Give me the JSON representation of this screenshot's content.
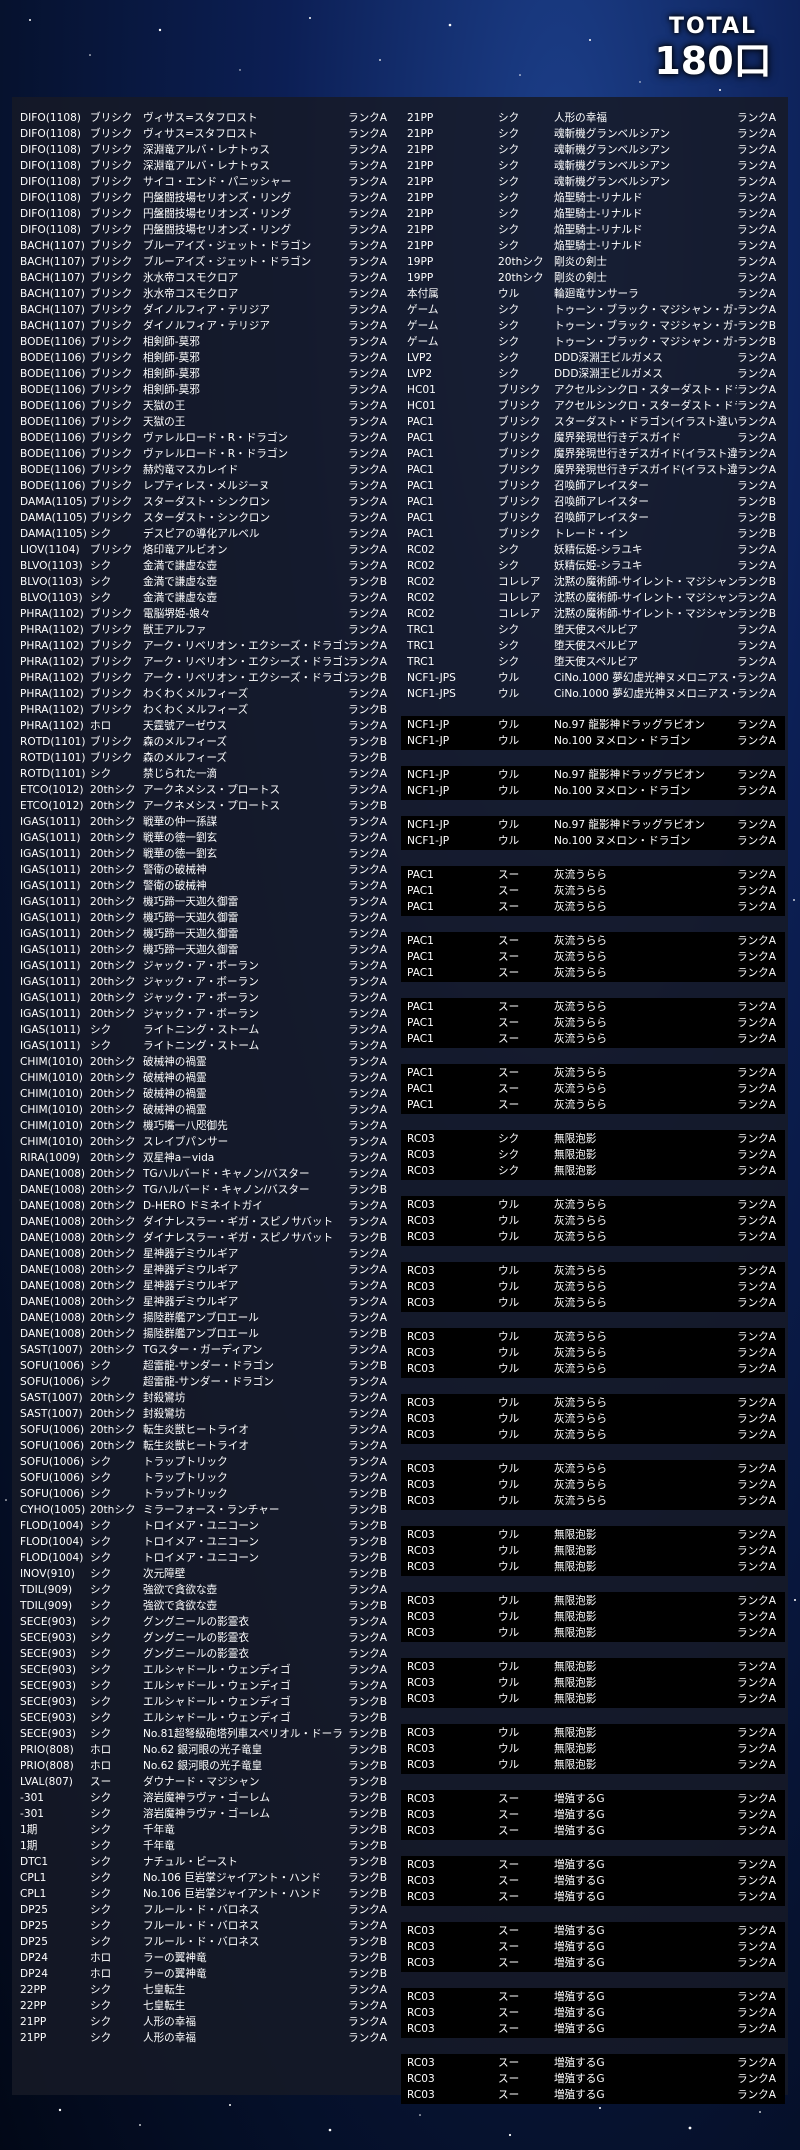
{
  "header": {
    "total_label": "TOTAL",
    "total_count": "180口"
  },
  "left_rows": [
    [
      "DIFO(1108)",
      "ブリシク",
      "ヴィサス=スタフロスト",
      "ランクA"
    ],
    [
      "DIFO(1108)",
      "ブリシク",
      "ヴィサス=スタフロスト",
      "ランクA"
    ],
    [
      "DIFO(1108)",
      "ブリシク",
      "深淵竜アルバ・レナトゥス",
      "ランクA"
    ],
    [
      "DIFO(1108)",
      "ブリシク",
      "深淵竜アルバ・レナトゥス",
      "ランクA"
    ],
    [
      "DIFO(1108)",
      "ブリシク",
      "サイコ・エンド・パニッシャー",
      "ランクA"
    ],
    [
      "DIFO(1108)",
      "ブリシク",
      "円盤闘技場セリオンズ・リング",
      "ランクA"
    ],
    [
      "DIFO(1108)",
      "ブリシク",
      "円盤闘技場セリオンズ・リング",
      "ランクA"
    ],
    [
      "DIFO(1108)",
      "ブリシク",
      "円盤闘技場セリオンズ・リング",
      "ランクA"
    ],
    [
      "BACH(1107)",
      "ブリシク",
      "ブルーアイズ・ジェット・ドラゴン",
      "ランクA"
    ],
    [
      "BACH(1107)",
      "ブリシク",
      "ブルーアイズ・ジェット・ドラゴン",
      "ランクA"
    ],
    [
      "BACH(1107)",
      "ブリシク",
      "氷水帝コスモクロア",
      "ランクA"
    ],
    [
      "BACH(1107)",
      "ブリシク",
      "氷水帝コスモクロア",
      "ランクA"
    ],
    [
      "BACH(1107)",
      "ブリシク",
      "ダイノルフィア・テリジア",
      "ランクA"
    ],
    [
      "BACH(1107)",
      "ブリシク",
      "ダイノルフィア・テリジア",
      "ランクA"
    ],
    [
      "BODE(1106)",
      "ブリシク",
      "相剣師-莫邪",
      "ランクA"
    ],
    [
      "BODE(1106)",
      "ブリシク",
      "相剣師-莫邪",
      "ランクA"
    ],
    [
      "BODE(1106)",
      "ブリシク",
      "相剣師-莫邪",
      "ランクA"
    ],
    [
      "BODE(1106)",
      "ブリシク",
      "相剣師-莫邪",
      "ランクA"
    ],
    [
      "BODE(1106)",
      "ブリシク",
      "天獄の王",
      "ランクA"
    ],
    [
      "BODE(1106)",
      "ブリシク",
      "天獄の王",
      "ランクA"
    ],
    [
      "BODE(1106)",
      "ブリシク",
      "ヴァレルロード・R・ドラゴン",
      "ランクA"
    ],
    [
      "BODE(1106)",
      "ブリシク",
      "ヴァレルロード・R・ドラゴン",
      "ランクA"
    ],
    [
      "BODE(1106)",
      "ブリシク",
      "赫灼竜マスカレイド",
      "ランクA"
    ],
    [
      "BODE(1106)",
      "ブリシク",
      "レプティレス・メルジーヌ",
      "ランクA"
    ],
    [
      "DAMA(1105)",
      "ブリシク",
      "スターダスト・シンクロン",
      "ランクA"
    ],
    [
      "DAMA(1105)",
      "ブリシク",
      "スターダスト・シンクロン",
      "ランクA"
    ],
    [
      "DAMA(1105)",
      "シク",
      "デスピアの導化アルベル",
      "ランクA"
    ],
    [
      "LIOV(1104)",
      "ブリシク",
      "烙印竜アルビオン",
      "ランクA"
    ],
    [
      "BLVO(1103)",
      "シク",
      "金満で謙虚な壺",
      "ランクA"
    ],
    [
      "BLVO(1103)",
      "シク",
      "金満で謙虚な壺",
      "ランクB"
    ],
    [
      "BLVO(1103)",
      "シク",
      "金満で謙虚な壺",
      "ランクA"
    ],
    [
      "PHRA(1102)",
      "ブリシク",
      "電脳堺姫-娘々",
      "ランクA"
    ],
    [
      "PHRA(1102)",
      "ブリシク",
      "獣王アルファ",
      "ランクA"
    ],
    [
      "PHRA(1102)",
      "ブリシク",
      "アーク・リベリオン・エクシーズ・ドラゴン",
      "ランクA"
    ],
    [
      "PHRA(1102)",
      "ブリシク",
      "アーク・リベリオン・エクシーズ・ドラゴン",
      "ランクA"
    ],
    [
      "PHRA(1102)",
      "ブリシク",
      "アーク・リベリオン・エクシーズ・ドラゴン",
      "ランクB"
    ],
    [
      "PHRA(1102)",
      "ブリシク",
      "わくわくメルフィーズ",
      "ランクA"
    ],
    [
      "PHRA(1102)",
      "ブリシク",
      "わくわくメルフィーズ",
      "ランクB"
    ],
    [
      "PHRA(1102)",
      "ホロ",
      "天霆號アーゼウス",
      "ランクA"
    ],
    [
      "ROTD(1101)",
      "ブリシク",
      "森のメルフィーズ",
      "ランクB"
    ],
    [
      "ROTD(1101)",
      "ブリシク",
      "森のメルフィーズ",
      "ランクB"
    ],
    [
      "ROTD(1101)",
      "シク",
      "禁じられた一滴",
      "ランクA"
    ],
    [
      "ETCO(1012)",
      "20thシク",
      "アークネメシス・プロートス",
      "ランクA"
    ],
    [
      "ETCO(1012)",
      "20thシク",
      "アークネメシス・プロートス",
      "ランクB"
    ],
    [
      "IGAS(1011)",
      "20thシク",
      "戦華の仲一孫謀",
      "ランクA"
    ],
    [
      "IGAS(1011)",
      "20thシク",
      "戦華の徳一劉玄",
      "ランクA"
    ],
    [
      "IGAS(1011)",
      "20thシク",
      "戦華の徳一劉玄",
      "ランクA"
    ],
    [
      "IGAS(1011)",
      "20thシク",
      "警衛の破械神",
      "ランクA"
    ],
    [
      "IGAS(1011)",
      "20thシク",
      "警衛の破械神",
      "ランクA"
    ],
    [
      "IGAS(1011)",
      "20thシク",
      "機巧蹄一天迦久御雷",
      "ランクA"
    ],
    [
      "IGAS(1011)",
      "20thシク",
      "機巧蹄一天迦久御雷",
      "ランクA"
    ],
    [
      "IGAS(1011)",
      "20thシク",
      "機巧蹄一天迦久御雷",
      "ランクA"
    ],
    [
      "IGAS(1011)",
      "20thシク",
      "機巧蹄一天迦久御雷",
      "ランクA"
    ],
    [
      "IGAS(1011)",
      "20thシク",
      "ジャック・ア・ボーラン",
      "ランクA"
    ],
    [
      "IGAS(1011)",
      "20thシク",
      "ジャック・ア・ボーラン",
      "ランクA"
    ],
    [
      "IGAS(1011)",
      "20thシク",
      "ジャック・ア・ボーラン",
      "ランクA"
    ],
    [
      "IGAS(1011)",
      "20thシク",
      "ジャック・ア・ボーラン",
      "ランクA"
    ],
    [
      "IGAS(1011)",
      "シク",
      "ライトニング・ストーム",
      "ランクA"
    ],
    [
      "IGAS(1011)",
      "シク",
      "ライトニング・ストーム",
      "ランクA"
    ],
    [
      "CHIM(1010)",
      "20thシク",
      "破械神の禍霊",
      "ランクA"
    ],
    [
      "CHIM(1010)",
      "20thシク",
      "破械神の禍霊",
      "ランクA"
    ],
    [
      "CHIM(1010)",
      "20thシク",
      "破械神の禍霊",
      "ランクA"
    ],
    [
      "CHIM(1010)",
      "20thシク",
      "破械神の禍霊",
      "ランクA"
    ],
    [
      "CHIM(1010)",
      "20thシク",
      "機巧嘴一八咫御先",
      "ランクA"
    ],
    [
      "CHIM(1010)",
      "20thシク",
      "スレイブパンサー",
      "ランクA"
    ],
    [
      "RIRA(1009)",
      "20thシク",
      "双星神a－vida",
      "ランクA"
    ],
    [
      "DANE(1008)",
      "20thシク",
      "TGハルバード・キャノン/バスター",
      "ランクA"
    ],
    [
      "DANE(1008)",
      "20thシク",
      "TGハルバード・キャノン/バスター",
      "ランクB"
    ],
    [
      "DANE(1008)",
      "20thシク",
      "D-HERO ドミネイトガイ",
      "ランクA"
    ],
    [
      "DANE(1008)",
      "20thシク",
      "ダイナレスラー・ギガ・スピノサバット",
      "ランクA"
    ],
    [
      "DANE(1008)",
      "20thシク",
      "ダイナレスラー・ギガ・スピノサバット",
      "ランクB"
    ],
    [
      "DANE(1008)",
      "20thシク",
      "星神器デミウルギア",
      "ランクA"
    ],
    [
      "DANE(1008)",
      "20thシク",
      "星神器デミウルギア",
      "ランクA"
    ],
    [
      "DANE(1008)",
      "20thシク",
      "星神器デミウルギア",
      "ランクA"
    ],
    [
      "DANE(1008)",
      "20thシク",
      "星神器デミウルギア",
      "ランクA"
    ],
    [
      "DANE(1008)",
      "20thシク",
      "揚陸群艦アンブロエール",
      "ランクA"
    ],
    [
      "DANE(1008)",
      "20thシク",
      "揚陸群艦アンブロエール",
      "ランクB"
    ],
    [
      "SAST(1007)",
      "20thシク",
      "TGスター・ガーディアン",
      "ランクA"
    ],
    [
      "SOFU(1006)",
      "シク",
      "超雷龍-サンダー・ドラゴン",
      "ランクB"
    ],
    [
      "SOFU(1006)",
      "シク",
      "超雷龍-サンダー・ドラゴン",
      "ランクA"
    ],
    [
      "SAST(1007)",
      "20thシク",
      "封殺鸞坊",
      "ランクA"
    ],
    [
      "SAST(1007)",
      "20thシク",
      "封殺鸞坊",
      "ランクA"
    ],
    [
      "SOFU(1006)",
      "20thシク",
      "転生炎獣ヒートライオ",
      "ランクA"
    ],
    [
      "SOFU(1006)",
      "20thシク",
      "転生炎獣ヒートライオ",
      "ランクA"
    ],
    [
      "SOFU(1006)",
      "シク",
      "トラップトリック",
      "ランクA"
    ],
    [
      "SOFU(1006)",
      "シク",
      "トラップトリック",
      "ランクA"
    ],
    [
      "SOFU(1006)",
      "シク",
      "トラップトリック",
      "ランクB"
    ],
    [
      "CYHO(1005)",
      "20thシク",
      "ミラーフォース・ランチャー",
      "ランクB"
    ],
    [
      "FLOD(1004)",
      "シク",
      "トロイメア・ユニコーン",
      "ランクB"
    ],
    [
      "FLOD(1004)",
      "シク",
      "トロイメア・ユニコーン",
      "ランクB"
    ],
    [
      "FLOD(1004)",
      "シク",
      "トロイメア・ユニコーン",
      "ランクB"
    ],
    [
      "INOV(910)",
      "シク",
      "次元障壁",
      "ランクB"
    ],
    [
      "TDIL(909)",
      "シク",
      "強欲で貪欲な壺",
      "ランクA"
    ],
    [
      "TDIL(909)",
      "シク",
      "強欲で貪欲な壺",
      "ランクB"
    ],
    [
      "SECE(903)",
      "シク",
      "グングニールの影霊衣",
      "ランクA"
    ],
    [
      "SECE(903)",
      "シク",
      "グングニールの影霊衣",
      "ランクA"
    ],
    [
      "SECE(903)",
      "シク",
      "グングニールの影霊衣",
      "ランクA"
    ],
    [
      "SECE(903)",
      "シク",
      "エルシャドール・ウェンディゴ",
      "ランクA"
    ],
    [
      "SECE(903)",
      "シク",
      "エルシャドール・ウェンディゴ",
      "ランクA"
    ],
    [
      "SECE(903)",
      "シク",
      "エルシャドール・ウェンディゴ",
      "ランクB"
    ],
    [
      "SECE(903)",
      "シク",
      "エルシャドール・ウェンディゴ",
      "ランクB"
    ],
    [
      "SECE(903)",
      "シク",
      "No.81超弩級砲塔列車スペリオル・ドーラ",
      "ランクB"
    ],
    [
      "PRIO(808)",
      "ホロ",
      "No.62 銀河眼の光子竜皇",
      "ランクB"
    ],
    [
      "PRIO(808)",
      "ホロ",
      "No.62 銀河眼の光子竜皇",
      "ランクB"
    ],
    [
      "LVAL(807)",
      "スー",
      "ダウナード・マジシャン",
      "ランクB"
    ],
    [
      "-301",
      "シク",
      "溶岩魔神ラヴァ・ゴーレム",
      "ランクB"
    ],
    [
      "-301",
      "シク",
      "溶岩魔神ラヴァ・ゴーレム",
      "ランクB"
    ],
    [
      "1期",
      "シク",
      "千年竜",
      "ランクB"
    ],
    [
      "1期",
      "シク",
      "千年竜",
      "ランクB"
    ],
    [
      "DTC1",
      "シク",
      "ナチュル・ビースト",
      "ランクB"
    ],
    [
      "CPL1",
      "シク",
      "No.106 巨岩掌ジャイアント・ハンド",
      "ランクB"
    ],
    [
      "CPL1",
      "シク",
      "No.106 巨岩掌ジャイアント・ハンド",
      "ランクB"
    ],
    [
      "DP25",
      "シク",
      "フルール・ド・バロネス",
      "ランクA"
    ],
    [
      "DP25",
      "シク",
      "フルール・ド・バロネス",
      "ランクA"
    ],
    [
      "DP25",
      "シク",
      "フルール・ド・バロネス",
      "ランクB"
    ],
    [
      "DP24",
      "ホロ",
      "ラーの翼神竜",
      "ランクB"
    ],
    [
      "DP24",
      "ホロ",
      "ラーの翼神竜",
      "ランクB"
    ],
    [
      "22PP",
      "シク",
      "七皇転生",
      "ランクA"
    ],
    [
      "22PP",
      "シク",
      "七皇転生",
      "ランクA"
    ],
    [
      "21PP",
      "シク",
      "人形の幸福",
      "ランクA"
    ],
    [
      "21PP",
      "シク",
      "人形の幸福",
      "ランクA"
    ]
  ],
  "right_rows": [
    [
      "21PP",
      "シク",
      "人形の幸福",
      "ランクA"
    ],
    [
      "21PP",
      "シク",
      "魂斬機グランベルシアン",
      "ランクA"
    ],
    [
      "21PP",
      "シク",
      "魂斬機グランベルシアン",
      "ランクA"
    ],
    [
      "21PP",
      "シク",
      "魂斬機グランベルシアン",
      "ランクA"
    ],
    [
      "21PP",
      "シク",
      "魂斬機グランベルシアン",
      "ランクA"
    ],
    [
      "21PP",
      "シク",
      "焔聖騎士-リナルド",
      "ランクA"
    ],
    [
      "21PP",
      "シク",
      "焔聖騎士-リナルド",
      "ランクA"
    ],
    [
      "21PP",
      "シク",
      "焔聖騎士-リナルド",
      "ランクA"
    ],
    [
      "21PP",
      "シク",
      "焔聖騎士-リナルド",
      "ランクA"
    ],
    [
      "19PP",
      "20thシク",
      "剛炎の剣士",
      "ランクA"
    ],
    [
      "19PP",
      "20thシク",
      "剛炎の剣士",
      "ランクA"
    ],
    [
      "本付属",
      "ウル",
      "輪廻竜サンサーラ",
      "ランクA"
    ],
    [
      "ゲーム",
      "シク",
      "トゥーン・ブラック・マジシャン・ガール",
      "ランクA"
    ],
    [
      "ゲーム",
      "シク",
      "トゥーン・ブラック・マジシャン・ガール",
      "ランクB"
    ],
    [
      "ゲーム",
      "シク",
      "トゥーン・ブラック・マジシャン・ガール",
      "ランクB"
    ],
    [
      "LVP2",
      "シク",
      "DDD深淵王ビルガメス",
      "ランクA"
    ],
    [
      "LVP2",
      "シク",
      "DDD深淵王ビルガメス",
      "ランクA"
    ],
    [
      "HC01",
      "ブリシク",
      "アクセルシンクロ・スターダスト・ドラゴン",
      "ランクA"
    ],
    [
      "HC01",
      "ブリシク",
      "アクセルシンクロ・スターダスト・ドラゴン",
      "ランクA"
    ],
    [
      "PAC1",
      "ブリシク",
      "スターダスト・ドラゴン(イラスト違い)",
      "ランクA"
    ],
    [
      "PAC1",
      "ブリシク",
      "魔界発現世行きデスガイド",
      "ランクA"
    ],
    [
      "PAC1",
      "ブリシク",
      "魔界発現世行きデスガイド(イラスト違い)",
      "ランクA"
    ],
    [
      "PAC1",
      "ブリシク",
      "魔界発現世行きデスガイド(イラスト違い)",
      "ランクA"
    ],
    [
      "PAC1",
      "ブリシク",
      "召喚師アレイスター",
      "ランクA"
    ],
    [
      "PAC1",
      "ブリシク",
      "召喚師アレイスター",
      "ランクB"
    ],
    [
      "PAC1",
      "ブリシク",
      "召喚師アレイスター",
      "ランクB"
    ],
    [
      "PAC1",
      "ブリシク",
      "トレード・イン",
      "ランクB"
    ],
    [
      "RC02",
      "シク",
      "妖精伝姫-シラユキ",
      "ランクA"
    ],
    [
      "RC02",
      "シク",
      "妖精伝姫-シラユキ",
      "ランクA"
    ],
    [
      "RC02",
      "コレレア",
      "沈黙の魔術師-サイレント・マジシャン",
      "ランクB"
    ],
    [
      "RC02",
      "コレレア",
      "沈黙の魔術師-サイレント・マジシャン",
      "ランクA"
    ],
    [
      "RC02",
      "コレレア",
      "沈黙の魔術師-サイレント・マジシャン",
      "ランクB"
    ],
    [
      "TRC1",
      "シク",
      "堕天使スペルビア",
      "ランクA"
    ],
    [
      "TRC1",
      "シク",
      "堕天使スペルビア",
      "ランクA"
    ],
    [
      "TRC1",
      "シク",
      "堕天使スペルビア",
      "ランクA"
    ],
    [
      "NCF1-JPS",
      "ウル",
      "CiNo.1000 夢幻虚光神ヌメロニアス・ヌメロニア",
      "ランクA"
    ],
    [
      "NCF1-JPS",
      "ウル",
      "CiNo.1000 夢幻虚光神ヌメロニアス・ヌメロニア",
      "ランクA"
    ]
  ],
  "right_blocks": [
    [
      [
        "NCF1-JP",
        "ウル",
        "No.97 龍影神ドラッグラビオン",
        "ランクA"
      ],
      [
        "NCF1-JP",
        "ウル",
        "No.100 ヌメロン・ドラゴン",
        "ランクA"
      ]
    ],
    [
      [
        "NCF1-JP",
        "ウル",
        "No.97 龍影神ドラッグラビオン",
        "ランクA"
      ],
      [
        "NCF1-JP",
        "ウル",
        "No.100 ヌメロン・ドラゴン",
        "ランクA"
      ]
    ],
    [
      [
        "NCF1-JP",
        "ウル",
        "No.97 龍影神ドラッグラビオン",
        "ランクA"
      ],
      [
        "NCF1-JP",
        "ウル",
        "No.100 ヌメロン・ドラゴン",
        "ランクA"
      ]
    ],
    [
      [
        "PAC1",
        "スー",
        "灰流うらら",
        "ランクA"
      ],
      [
        "PAC1",
        "スー",
        "灰流うらら",
        "ランクA"
      ],
      [
        "PAC1",
        "スー",
        "灰流うらら",
        "ランクA"
      ]
    ],
    [
      [
        "PAC1",
        "スー",
        "灰流うらら",
        "ランクA"
      ],
      [
        "PAC1",
        "スー",
        "灰流うらら",
        "ランクA"
      ],
      [
        "PAC1",
        "スー",
        "灰流うらら",
        "ランクA"
      ]
    ],
    [
      [
        "PAC1",
        "スー",
        "灰流うらら",
        "ランクA"
      ],
      [
        "PAC1",
        "スー",
        "灰流うらら",
        "ランクA"
      ],
      [
        "PAC1",
        "スー",
        "灰流うらら",
        "ランクA"
      ]
    ],
    [
      [
        "PAC1",
        "スー",
        "灰流うらら",
        "ランクA"
      ],
      [
        "PAC1",
        "スー",
        "灰流うらら",
        "ランクA"
      ],
      [
        "PAC1",
        "スー",
        "灰流うらら",
        "ランクA"
      ]
    ],
    [
      [
        "RC03",
        "シク",
        "無限泡影",
        "ランクA"
      ],
      [
        "RC03",
        "シク",
        "無限泡影",
        "ランクA"
      ],
      [
        "RC03",
        "シク",
        "無限泡影",
        "ランクA"
      ]
    ],
    [
      [
        "RC03",
        "ウル",
        "灰流うらら",
        "ランクA"
      ],
      [
        "RC03",
        "ウル",
        "灰流うらら",
        "ランクA"
      ],
      [
        "RC03",
        "ウル",
        "灰流うらら",
        "ランクA"
      ]
    ],
    [
      [
        "RC03",
        "ウル",
        "灰流うらら",
        "ランクA"
      ],
      [
        "RC03",
        "ウル",
        "灰流うらら",
        "ランクA"
      ],
      [
        "RC03",
        "ウル",
        "灰流うらら",
        "ランクA"
      ]
    ],
    [
      [
        "RC03",
        "ウル",
        "灰流うらら",
        "ランクA"
      ],
      [
        "RC03",
        "ウル",
        "灰流うらら",
        "ランクA"
      ],
      [
        "RC03",
        "ウル",
        "灰流うらら",
        "ランクA"
      ]
    ],
    [
      [
        "RC03",
        "ウル",
        "灰流うらら",
        "ランクA"
      ],
      [
        "RC03",
        "ウル",
        "灰流うらら",
        "ランクA"
      ],
      [
        "RC03",
        "ウル",
        "灰流うらら",
        "ランクA"
      ]
    ],
    [
      [
        "RC03",
        "ウル",
        "灰流うらら",
        "ランクA"
      ],
      [
        "RC03",
        "ウル",
        "灰流うらら",
        "ランクA"
      ],
      [
        "RC03",
        "ウル",
        "灰流うらら",
        "ランクA"
      ]
    ],
    [
      [
        "RC03",
        "ウル",
        "無限泡影",
        "ランクA"
      ],
      [
        "RC03",
        "ウル",
        "無限泡影",
        "ランクA"
      ],
      [
        "RC03",
        "ウル",
        "無限泡影",
        "ランクA"
      ]
    ],
    [
      [
        "RC03",
        "ウル",
        "無限泡影",
        "ランクA"
      ],
      [
        "RC03",
        "ウル",
        "無限泡影",
        "ランクA"
      ],
      [
        "RC03",
        "ウル",
        "無限泡影",
        "ランクA"
      ]
    ],
    [
      [
        "RC03",
        "ウル",
        "無限泡影",
        "ランクA"
      ],
      [
        "RC03",
        "ウル",
        "無限泡影",
        "ランクA"
      ],
      [
        "RC03",
        "ウル",
        "無限泡影",
        "ランクA"
      ]
    ],
    [
      [
        "RC03",
        "ウル",
        "無限泡影",
        "ランクA"
      ],
      [
        "RC03",
        "ウル",
        "無限泡影",
        "ランクA"
      ],
      [
        "RC03",
        "ウル",
        "無限泡影",
        "ランクA"
      ]
    ],
    [
      [
        "RC03",
        "スー",
        "増殖するG",
        "ランクA"
      ],
      [
        "RC03",
        "スー",
        "増殖するG",
        "ランクA"
      ],
      [
        "RC03",
        "スー",
        "増殖するG",
        "ランクA"
      ]
    ],
    [
      [
        "RC03",
        "スー",
        "増殖するG",
        "ランクA"
      ],
      [
        "RC03",
        "スー",
        "増殖するG",
        "ランクA"
      ],
      [
        "RC03",
        "スー",
        "増殖するG",
        "ランクA"
      ]
    ],
    [
      [
        "RC03",
        "スー",
        "増殖するG",
        "ランクA"
      ],
      [
        "RC03",
        "スー",
        "増殖するG",
        "ランクA"
      ],
      [
        "RC03",
        "スー",
        "増殖するG",
        "ランクA"
      ]
    ],
    [
      [
        "RC03",
        "スー",
        "増殖するG",
        "ランクA"
      ],
      [
        "RC03",
        "スー",
        "増殖するG",
        "ランクA"
      ],
      [
        "RC03",
        "スー",
        "増殖するG",
        "ランクA"
      ]
    ],
    [
      [
        "RC03",
        "スー",
        "増殖するG",
        "ランクA"
      ],
      [
        "RC03",
        "スー",
        "増殖するG",
        "ランクA"
      ],
      [
        "RC03",
        "スー",
        "増殖するG",
        "ランクA"
      ]
    ]
  ]
}
